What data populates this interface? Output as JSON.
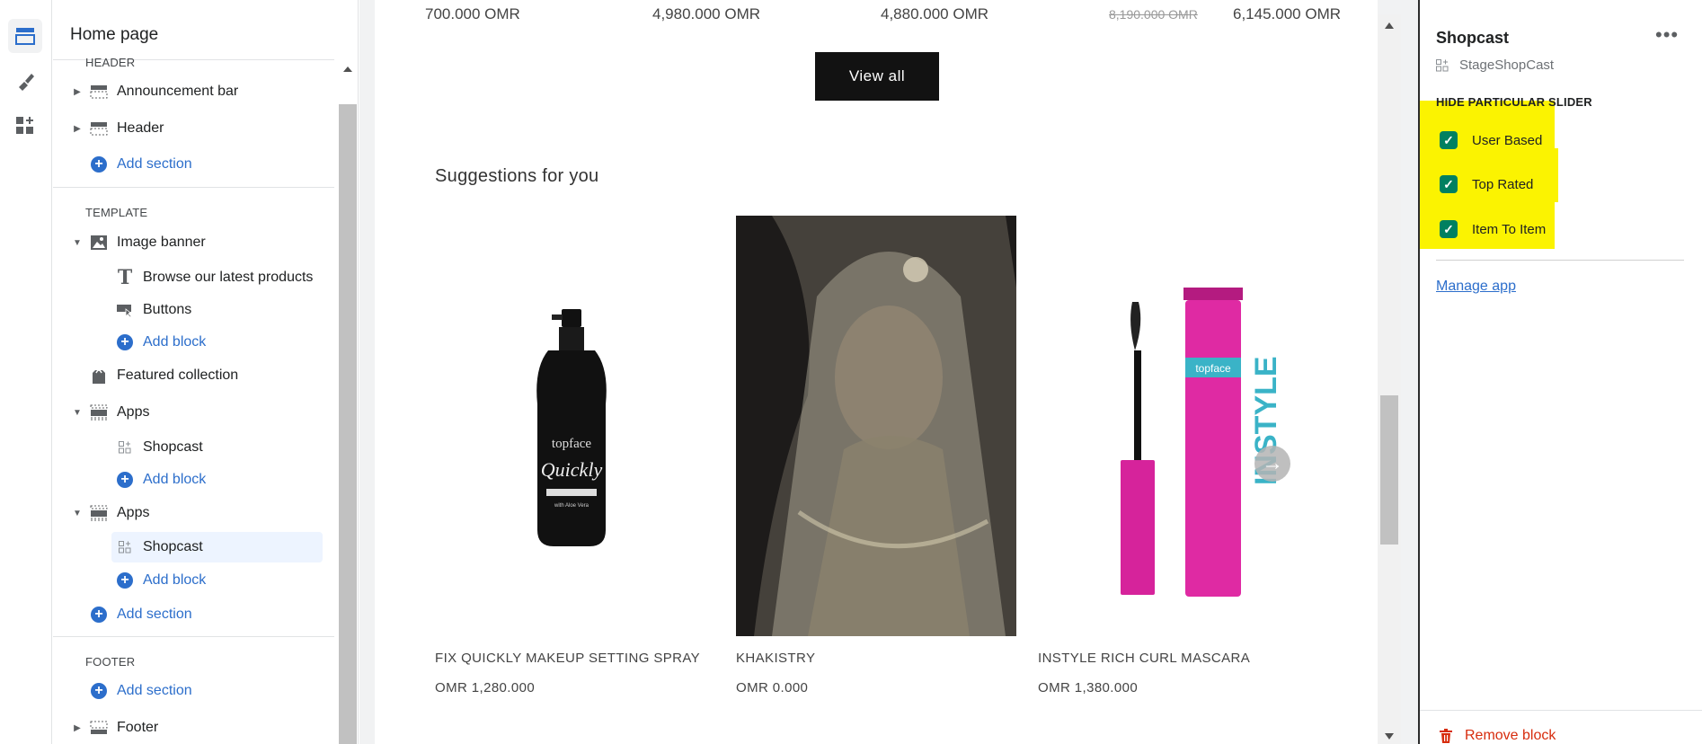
{
  "sidebar": {
    "title": "Home page",
    "header_label": "HEADER",
    "template_label": "TEMPLATE",
    "footer_label": "FOOTER",
    "items": {
      "announcement": "Announcement bar",
      "header": "Header",
      "add_section_1": "Add section",
      "image_banner": "Image banner",
      "browse": "Browse our latest products",
      "buttons": "Buttons",
      "add_block_1": "Add block",
      "featured": "Featured collection",
      "apps_1": "Apps",
      "shopcast_1": "Shopcast",
      "add_block_2": "Add block",
      "apps_2": "Apps",
      "shopcast_2": "Shopcast",
      "add_block_3": "Add block",
      "add_section_2": "Add section",
      "add_section_3": "Add section",
      "footer": "Footer"
    }
  },
  "preview": {
    "top_prices": [
      "700.000 OMR",
      "4,980.000 OMR",
      "4,880.000 OMR",
      "8,190.000 OMR",
      "6,145.000 OMR"
    ],
    "view_all": "View all",
    "suggestions_title": "Suggestions for you",
    "products": [
      {
        "name": "FIX QUICKLY MAKEUP SETTING SPRAY",
        "price": "OMR 1,280.000"
      },
      {
        "name": "KHAKISTRY",
        "price": "OMR 0.000"
      },
      {
        "name": "INSTYLE RICH CURL MASCARA",
        "price": "OMR 1,380.000"
      }
    ]
  },
  "panel": {
    "title": "Shopcast",
    "subtitle": "StageShopCast",
    "heading": "HIDE PARTICULAR SLIDER",
    "checkboxes": [
      {
        "label": "User Based",
        "checked": true
      },
      {
        "label": "Top Rated",
        "checked": true
      },
      {
        "label": "Item To Item",
        "checked": true
      }
    ],
    "manage_app": "Manage app",
    "remove_block": "Remove block",
    "highlight_color": "#fbf301",
    "check_color": "#008060"
  },
  "colors": {
    "link": "#2c6ecb",
    "danger": "#d72c0d"
  }
}
